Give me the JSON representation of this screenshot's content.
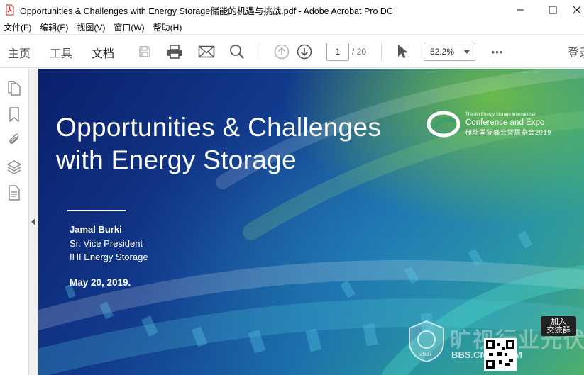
{
  "window": {
    "title": "Opportunities & Challenges with Energy Storage储能的机遇与挑战.pdf - Adobe Acrobat Pro DC",
    "minimize": "—",
    "maximize": "☐",
    "close": "✕"
  },
  "menu": [
    {
      "label": "文件(F)"
    },
    {
      "label": "编辑(E)"
    },
    {
      "label": "视图(V)"
    },
    {
      "label": "窗口(W)"
    },
    {
      "label": "帮助(H)"
    }
  ],
  "toolbar": {
    "tabs": [
      {
        "label": "主页",
        "active": false
      },
      {
        "label": "工具",
        "active": false
      },
      {
        "label": "文档",
        "active": true
      }
    ],
    "icons": [
      "save-icon",
      "print-icon",
      "email-icon",
      "search-icon",
      "page-up-icon",
      "page-down-icon",
      "select-pointer-icon",
      "more-icon"
    ],
    "page_current": "1",
    "page_total": "/ 20",
    "zoom": "52.2%",
    "more": "•••",
    "login": "登录"
  },
  "sidebar": {
    "icons": [
      "pages-icon",
      "bookmark-icon",
      "attachment-icon",
      "layers-icon",
      "document-properties-icon"
    ]
  },
  "slide": {
    "title_line1": "Opportunities & Challenges",
    "title_line2": "with Energy Storage",
    "presenter_name": "Jamal Burki",
    "presenter_role": "Sr. Vice President",
    "presenter_company": "IHI Energy Storage",
    "date": "May 20, 2019.",
    "conference": {
      "small": "The 8th Energy Storage International",
      "main": "Conference and Expo",
      "cn": "储能国际峰会暨展览会2019"
    }
  },
  "watermark": {
    "brand": "旷视行业光伏论坛",
    "url": "BBS.CNPV.COM",
    "year": "2007",
    "join": "加入\n交流群"
  },
  "colors": {
    "accent": "#1473e6",
    "slide_dark": "#0a1f6a",
    "slide_green": "#4fb06a"
  }
}
